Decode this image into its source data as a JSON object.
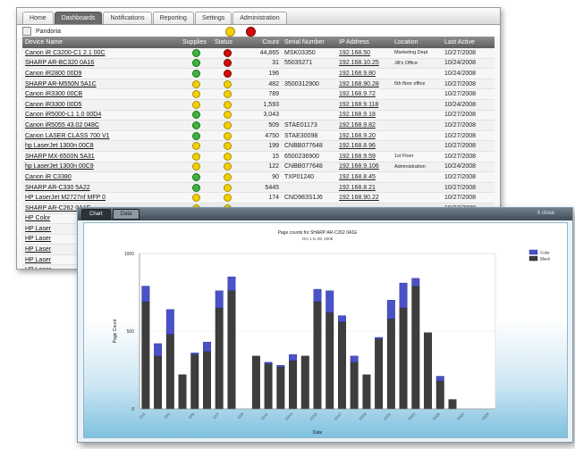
{
  "nav": {
    "tabs": [
      {
        "label": "Home"
      },
      {
        "label": "Dashboards"
      },
      {
        "label": "Notifications"
      },
      {
        "label": "Reporting"
      },
      {
        "label": "Settings"
      },
      {
        "label": "Administration"
      }
    ],
    "active_tab": "Dashboards"
  },
  "group": {
    "name": "Pandoria"
  },
  "table": {
    "headers": [
      "Device Name",
      "Supplies",
      "Status",
      "Count",
      "Serial Number",
      "IP Address",
      "Location",
      "Last Active"
    ],
    "rows": [
      {
        "name": "Canon iR C3200-C1 2.1 00C",
        "supplies": "green",
        "status": "red",
        "count": "44,865",
        "serial": "MSK03350",
        "ip": "192.168.50",
        "location": "Marketing Dept",
        "last": "10/27/2008"
      },
      {
        "name": "SHARP AR-BC320 0A16",
        "supplies": "green",
        "status": "red",
        "count": "31",
        "serial": "55035271",
        "ip": "192.168.10.25",
        "location": "Jill's Office",
        "last": "10/24/2008"
      },
      {
        "name": "Canon iR2800 00D9",
        "supplies": "green",
        "status": "red",
        "count": "196",
        "serial": "",
        "ip": "192.168.9.80",
        "location": "",
        "last": "10/24/2008"
      },
      {
        "name": "SHARP AR-M550N 5A1C",
        "supplies": "yellow",
        "status": "yellow",
        "count": "482",
        "serial": "3500312900",
        "ip": "192.168.90.28",
        "location": "5th floor office",
        "last": "10/27/2008"
      },
      {
        "name": "Canon iR3300 00CB",
        "supplies": "yellow",
        "status": "yellow",
        "count": "789",
        "serial": "",
        "ip": "192.168.9.72",
        "location": "",
        "last": "10/27/2008"
      },
      {
        "name": "Canon iR3300 00D5",
        "supplies": "yellow",
        "status": "yellow",
        "count": "1,593",
        "serial": "",
        "ip": "192.168.9.118",
        "location": "",
        "last": "10/24/2008"
      },
      {
        "name": "Canon iR5000-L1 1.0 00D4",
        "supplies": "green",
        "status": "yellow",
        "count": "3,043",
        "serial": "",
        "ip": "192.168.9.18",
        "location": "",
        "last": "10/27/2008"
      },
      {
        "name": "Canon iR5055 43.02 048C",
        "supplies": "green",
        "status": "yellow",
        "count": "509",
        "serial": "STAE01173",
        "ip": "192.168.9.82",
        "location": "",
        "last": "10/27/2008"
      },
      {
        "name": "Canon LASER CLASS 700 V1",
        "supplies": "green",
        "status": "yellow",
        "count": "4750",
        "serial": "STAE30098",
        "ip": "192.168.9.20",
        "location": "",
        "last": "10/27/2008"
      },
      {
        "name": "hp LaserJet 1300n 00C8",
        "supplies": "yellow",
        "status": "yellow",
        "count": "199",
        "serial": "CNBB077648",
        "ip": "192.168.8.96",
        "location": "",
        "last": "10/27/2008"
      },
      {
        "name": "SHARP MX-6500N 5A31",
        "supplies": "yellow",
        "status": "yellow",
        "count": "15",
        "serial": "6500236900",
        "ip": "192.168.9.59",
        "location": "1st Floor",
        "last": "10/27/2008"
      },
      {
        "name": "hp LaserJet 1300n 00C9",
        "supplies": "yellow",
        "status": "yellow",
        "count": "122",
        "serial": "CNBB077648",
        "ip": "192.168.9.106",
        "location": "Administration",
        "last": "10/24/2008"
      },
      {
        "name": "Canon iR C3380",
        "supplies": "green",
        "status": "yellow",
        "count": "90",
        "serial": "TXP01240",
        "ip": "192.168.8.45",
        "location": "",
        "last": "10/27/2008"
      },
      {
        "name": "SHARP AR-C330 5A22",
        "supplies": "green",
        "status": "yellow",
        "count": "5445",
        "serial": "",
        "ip": "192.168.8.21",
        "location": "",
        "last": "10/27/2008"
      },
      {
        "name": "HP LaserJet M2727nf MFP 0",
        "supplies": "yellow",
        "status": "yellow",
        "count": "174",
        "serial": "CND983S1J6",
        "ip": "192.168.90.22",
        "location": "",
        "last": "10/27/2008"
      },
      {
        "name": "SHARP AR-C262 0A1E",
        "supplies": "yellow",
        "status": "yellow",
        "count": "",
        "serial": "",
        "ip": "",
        "location": "",
        "last": "10/27/2008"
      },
      {
        "name": "HP Color",
        "supplies": "",
        "status": "",
        "count": "",
        "serial": "",
        "ip": "",
        "location": "",
        "last": ""
      },
      {
        "name": "HP Laser",
        "supplies": "",
        "status": "",
        "count": "",
        "serial": "",
        "ip": "",
        "location": "",
        "last": ""
      },
      {
        "name": "HP Laser",
        "supplies": "",
        "status": "",
        "count": "",
        "serial": "",
        "ip": "",
        "location": "",
        "last": ""
      },
      {
        "name": "HP Laser",
        "supplies": "",
        "status": "",
        "count": "",
        "serial": "",
        "ip": "",
        "location": "",
        "last": ""
      },
      {
        "name": "HP Laser",
        "supplies": "",
        "status": "",
        "count": "",
        "serial": "",
        "ip": "",
        "location": "",
        "last": ""
      },
      {
        "name": "HP Laser",
        "supplies": "",
        "status": "",
        "count": "",
        "serial": "",
        "ip": "",
        "location": "",
        "last": ""
      }
    ]
  },
  "chart_window": {
    "tabs": [
      {
        "label": "Chart"
      },
      {
        "label": "Data"
      }
    ],
    "active_tab": "Chart",
    "close_label": "X close"
  },
  "colors": {
    "black_series": "#3d3d3d",
    "color_series": "#4a52c8",
    "active_tab": "#6b6b6b"
  },
  "chart_data": {
    "type": "bar",
    "stacked": true,
    "title": "Page counts for SHARP AR-C262 0A1E",
    "subtitle": "Oct 1 to 29, 2008",
    "xlabel": "Date",
    "ylabel": "Page Count",
    "ylim": [
      0,
      1000
    ],
    "yticks": [
      0,
      500,
      1000
    ],
    "categories": [
      "10/1",
      "10/2",
      "10/3",
      "10/4",
      "10/5",
      "10/6",
      "10/7",
      "10/8",
      "10/9",
      "10/10",
      "10/11",
      "10/12",
      "10/13",
      "10/14",
      "10/15",
      "10/16",
      "10/17",
      "10/18",
      "10/19",
      "10/20",
      "10/21",
      "10/22",
      "10/23",
      "10/24",
      "10/25",
      "10/26",
      "10/27",
      "10/28",
      "10/29"
    ],
    "series": [
      {
        "name": "Black",
        "values": [
          690,
          340,
          480,
          220,
          350,
          370,
          650,
          760,
          0,
          340,
          290,
          270,
          310,
          340,
          690,
          620,
          560,
          300,
          220,
          450,
          580,
          650,
          790,
          490,
          180,
          60,
          0,
          0,
          0
        ]
      },
      {
        "name": "Color",
        "values": [
          100,
          80,
          160,
          0,
          10,
          60,
          110,
          90,
          0,
          0,
          10,
          10,
          40,
          0,
          80,
          140,
          40,
          40,
          0,
          10,
          120,
          160,
          50,
          0,
          30,
          0,
          0,
          0,
          0
        ]
      }
    ],
    "totals": [
      790,
      420,
      640,
      220,
      360,
      430,
      760,
      850,
      640,
      340,
      300,
      280,
      350,
      340,
      770,
      760,
      600,
      340,
      220,
      460,
      700,
      810,
      840,
      490,
      210,
      60,
      0,
      0,
      0
    ],
    "legend": [
      "Color",
      "Black"
    ],
    "legend_position": "top-right",
    "grid": true
  }
}
